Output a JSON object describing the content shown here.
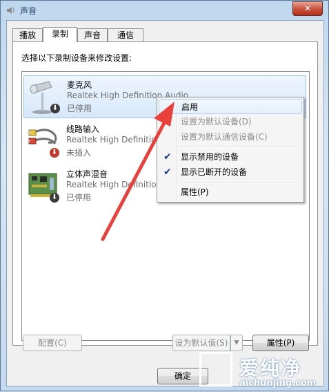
{
  "window": {
    "title": "声音",
    "close_symbol": "✕"
  },
  "tabs": [
    {
      "label": "播放",
      "active": false
    },
    {
      "label": "录制",
      "active": true
    },
    {
      "label": "声音",
      "active": false
    },
    {
      "label": "通信",
      "active": false
    }
  ],
  "panel": {
    "prompt": "选择以下录制设备来修改设置:"
  },
  "devices": [
    {
      "name": "麦克风",
      "driver": "Realtek High Definition Audio",
      "status": "已停用",
      "icon": "microphone-icon",
      "selected": true
    },
    {
      "name": "线路输入",
      "driver": "Realtek High Definition Audio",
      "status": "未插入",
      "icon": "line-in-cable-icon",
      "selected": false
    },
    {
      "name": "立体声混音",
      "driver": "Realtek High Definition Audio",
      "status": "已停用",
      "icon": "sound-card-icon",
      "selected": false
    }
  ],
  "context_menu": {
    "items": [
      {
        "label": "启用",
        "disabled": false,
        "checked": false,
        "hover": true
      },
      {
        "label": "设置为默认设备(D)",
        "disabled": true,
        "checked": false
      },
      {
        "label": "设置为默认通信设备(C)",
        "disabled": true,
        "checked": false
      },
      {
        "label": "显示禁用的设备",
        "disabled": false,
        "checked": true
      },
      {
        "label": "显示已断开的设备",
        "disabled": false,
        "checked": true
      },
      {
        "label": "属性(P)",
        "disabled": false,
        "checked": false
      }
    ]
  },
  "buttons": {
    "configure": "配置(C)",
    "set_default": "设为默认值(S)",
    "properties": "属性(P)",
    "ok": "确定"
  },
  "watermark": {
    "brand": "爱纯净",
    "url": "aichunjing.com"
  },
  "colors": {
    "annotation_arrow": "#e8413c",
    "accent_check": "#1c3d8c",
    "selection": "#d7e8fa"
  }
}
